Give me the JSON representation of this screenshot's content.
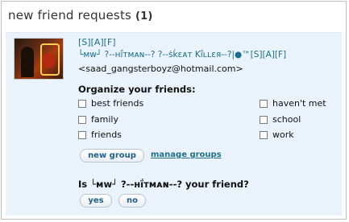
{
  "header": {
    "title": "new friend requests",
    "count": "(1)"
  },
  "request": {
    "name_line1": "[S][A][F]",
    "name_line2": "└ᴍᴡ┘ ?--ʜḯᴛᴍᴀɴ--? ?--ṡḱεᴀт Kḯʟʟεя--?|●™[S][A][F]",
    "email": "<saad_gangsterboyz@hotmail.com>"
  },
  "organize": {
    "title": "Organize your friends:",
    "groups": [
      "best friends",
      "family",
      "friends",
      "haven't met",
      "school",
      "work"
    ]
  },
  "actions": {
    "new_group": "new group",
    "manage_groups": "manage groups"
  },
  "confirm": {
    "question": "Is └ᴍᴡ┘ ?--ʜḯᴛᴍᴀɴ--? your friend?",
    "yes": "yes",
    "no": "no"
  }
}
